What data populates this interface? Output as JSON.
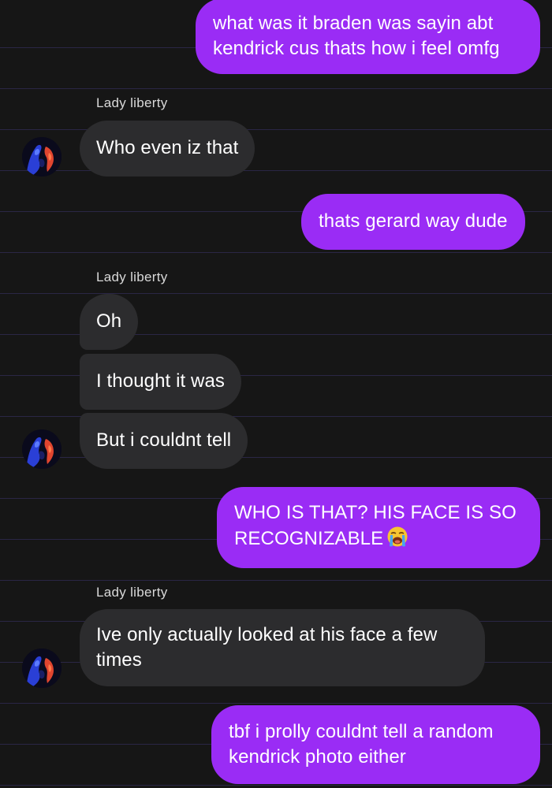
{
  "conversation": {
    "messages": [
      {
        "id": "m1",
        "direction": "outgoing",
        "text": "what was it braden was sayin abt kendrick cus thats how i feel omfg"
      },
      {
        "id": "m2",
        "direction": "incoming",
        "sender": "Lady liberty",
        "text": "Who even iz that"
      },
      {
        "id": "m3",
        "direction": "outgoing",
        "text": "thats gerard way dude"
      },
      {
        "id": "m4",
        "direction": "incoming",
        "sender": "Lady liberty",
        "text": "Oh"
      },
      {
        "id": "m5",
        "direction": "incoming",
        "sender": "Lady liberty",
        "text": "I thought it was"
      },
      {
        "id": "m6",
        "direction": "incoming",
        "sender": "Lady liberty",
        "text": "But i couldnt tell"
      },
      {
        "id": "m7",
        "direction": "outgoing",
        "text": "WHO IS THAT? HIS FACE IS SO RECOGNIZABLE",
        "emoji": "loudly-crying-face"
      },
      {
        "id": "m8",
        "direction": "incoming",
        "sender": "Lady liberty",
        "text": "Ive only actually looked at his face a few times"
      },
      {
        "id": "m9",
        "direction": "outgoing",
        "text": "tbf i prolly couldnt tell a random kendrick photo either"
      }
    ],
    "sender_labels": [
      "Lady liberty",
      "Lady liberty",
      "Lady liberty"
    ]
  },
  "colors": {
    "background": "#161616",
    "outgoing_bubble": "#9a2cf5",
    "incoming_bubble": "#2c2c2e",
    "text": "#ffffff",
    "divider_lines": "#2a2645"
  },
  "icons": {
    "avatar": "contact-avatar",
    "emoji": "loudly-crying-face-emoji"
  }
}
